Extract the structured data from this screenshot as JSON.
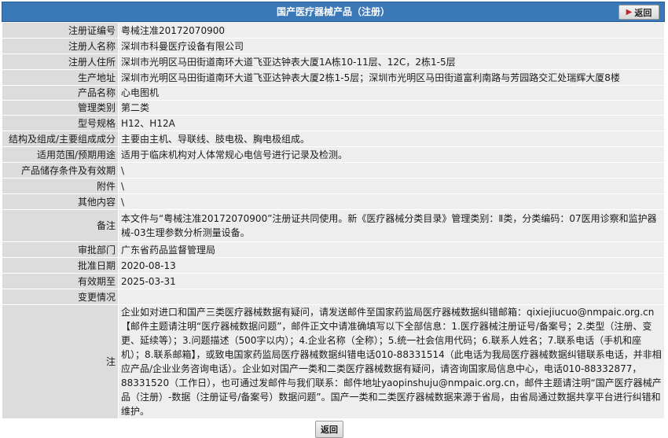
{
  "header": {
    "title": "国产医疗器械产品（注册）",
    "back_label": "返回"
  },
  "rows": [
    {
      "label": "注册证编号",
      "value": "粤械注准20172070900"
    },
    {
      "label": "注册人名称",
      "value": "深圳市科曼医疗设备有限公司"
    },
    {
      "label": "注册人住所",
      "value": "深圳市光明区马田街道南环大道飞亚达钟表大厦1A栋10-11层、12C，2栋1-5层"
    },
    {
      "label": "生产地址",
      "value": "深圳市光明区马田街道南环大道飞亚达钟表大厦2栋1-5层；深圳市光明区马田街道富利南路与芳园路交汇处瑞辉大厦8楼"
    },
    {
      "label": "产品名称",
      "value": "心电图机"
    },
    {
      "label": "管理类别",
      "value": "第二类"
    },
    {
      "label": "型号规格",
      "value": "H12、H12A"
    },
    {
      "label": "结构及组成/主要组成成分",
      "value": "主要由主机、导联线、肢电极、胸电极组成。"
    },
    {
      "label": "适用范围/预期用途",
      "value": "适用于临床机构对人体常规心电信号进行记录及检测。"
    },
    {
      "label": "产品储存条件及有效期",
      "value": "\\"
    },
    {
      "label": "附件",
      "value": "\\"
    },
    {
      "label": "其他内容",
      "value": "\\"
    },
    {
      "label": "备注",
      "value": "本文件与“粤械注准20172070900”注册证共同使用。新《医疗器械分类目录》管理类别：Ⅱ类，分类编码：07医用诊察和监护器械-03生理参数分析测量设备。"
    },
    {
      "label": "审批部门",
      "value": "广东省药品监督管理局"
    },
    {
      "label": "批准日期",
      "value": "2020-08-13"
    },
    {
      "label": "有效期至",
      "value": "2025-03-31"
    },
    {
      "label": "变更情况",
      "value": ""
    }
  ],
  "note": {
    "label": "注",
    "text": "企业如对进口和国产三类医疗器械数据有疑问，请发送邮件至国家药监局医疗器械数据纠错邮箱：qixiejiucuo@nmpaic.org.cn【邮件主题请注明“医疗器械数据问题”，邮件正文中请准确填写以下全部信息：1.医疗器械注册证号/备案号；2.类型（注册、变更、延续等）；3.问题描述（500字以内）；4.企业名称（全称）；5.统一社会信用代码；6.联系人姓名；7.联系电话（手机和座机）；8.联系邮箱】，或致电国家药监局医疗器械数据纠错电话010-88331514（此电话为我局医疗器械数据纠错联系电话，并非相应产品/企业业务咨询电话）。企业如对国产一类和二类医疗器械数据有疑问，请咨询国家局信息中心，电话010-88332877，88331520（工作日），也可通过发邮件与我们联系：邮件地址yaopinshuju@nmpaic.org.cn，邮件主题请注明“国产医疗器械产品（注册）-数据（注册证号/备案号）数据问题”。国产一类和二类医疗器械数据来源于省局，由省局通过数据共享平台进行纠错和维护。"
  },
  "footer": {
    "back_label": "返回"
  }
}
